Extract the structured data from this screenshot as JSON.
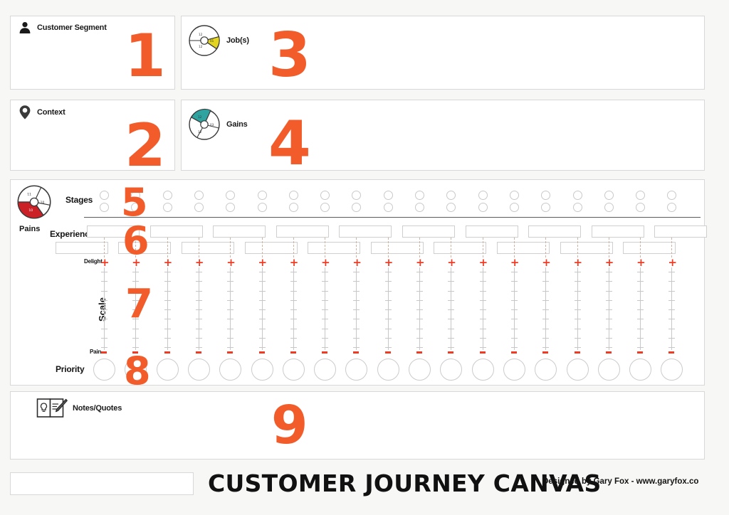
{
  "canvas": {
    "title": "CUSTOMER JOURNEY CANVAS",
    "credit": "Designed by Gary Fox - www.garyfox.co",
    "accent": "#f25c2a",
    "background": "#f7f7f5"
  },
  "panels": {
    "customer_segment": {
      "label": "Customer Segment",
      "number": "1",
      "icon": "person-icon"
    },
    "context": {
      "label": "Context",
      "number": "2",
      "icon": "location-pin-icon"
    },
    "jobs": {
      "label": "Job(s)",
      "number": "3",
      "icon": "jobs-wheel-icon",
      "wedge_color": "#e3d41f"
    },
    "gains": {
      "label": "Gains",
      "number": "4",
      "icon": "gains-wheel-icon",
      "wedge_color": "#2fa3a0"
    },
    "notes": {
      "label": "Notes/Quotes",
      "number": "9",
      "icon": "notebook-pencil-icon"
    }
  },
  "journey": {
    "pains": {
      "label": "Pains",
      "icon": "pains-wheel-icon",
      "wedge_color": "#cc2027"
    },
    "rows": {
      "stages": {
        "label": "Stages",
        "number": "5",
        "count": 19
      },
      "experience": {
        "label": "Experience",
        "number": "6",
        "top_count": 10,
        "bottom_count": 10
      },
      "scale": {
        "label": "Scale",
        "number": "7",
        "count": 19,
        "top_label": "Delight",
        "bottom_label": "Pain",
        "ticks": 9
      },
      "priority": {
        "label": "Priority",
        "number": "8",
        "count": 19
      }
    }
  },
  "footer": {
    "input_value": "",
    "title": "CUSTOMER JOURNEY CANVAS",
    "credit": "Designed by Gary Fox - www.garyfox.co"
  }
}
